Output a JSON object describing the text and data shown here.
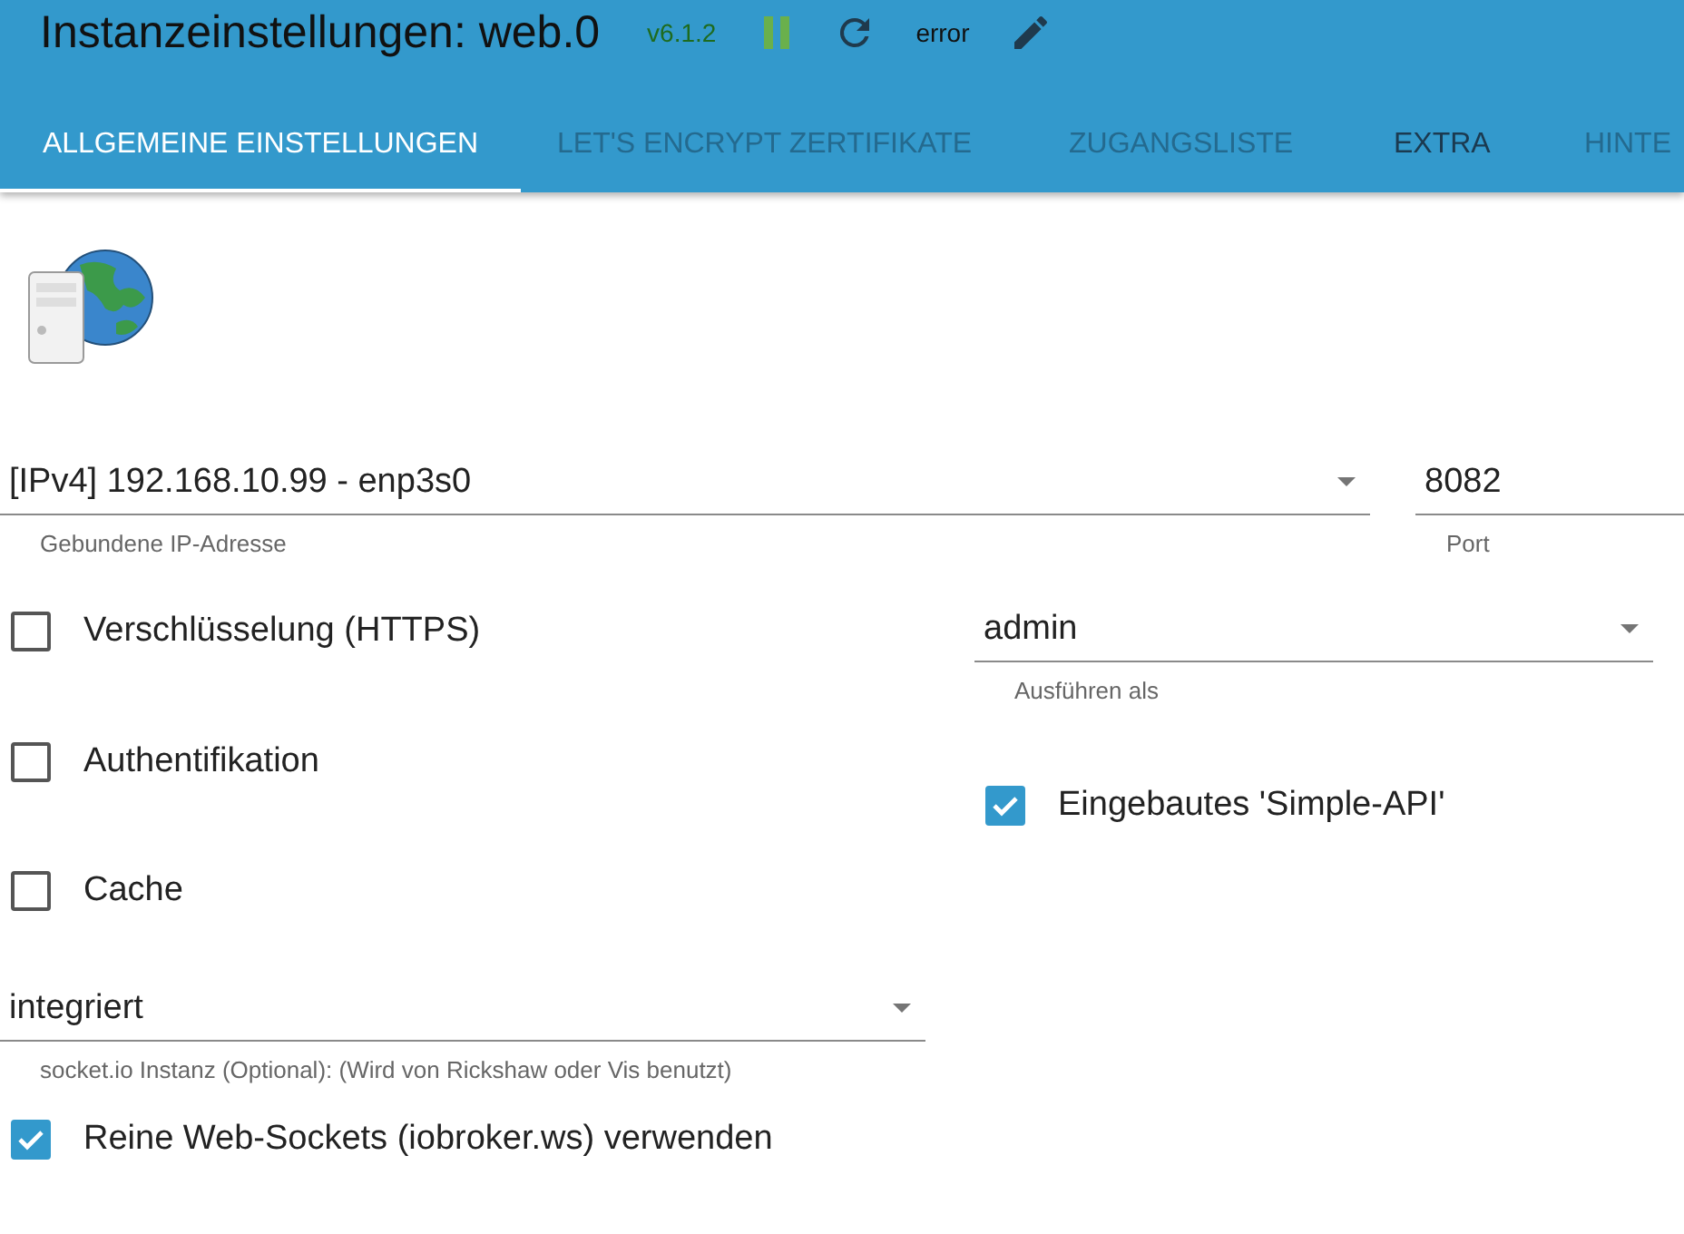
{
  "header": {
    "title": "Instanzeinstellungen: web.0",
    "version": "v6.1.2",
    "running": true,
    "status": "error"
  },
  "tabs": [
    {
      "label": "ALLGEMEINE EINSTELLUNGEN",
      "selected": true,
      "hover": false
    },
    {
      "label": "LET'S ENCRYPT ZERTIFIKATE",
      "selected": false,
      "hover": false
    },
    {
      "label": "ZUGANGSLISTE",
      "selected": false,
      "hover": false
    },
    {
      "label": "EXTRA",
      "selected": false,
      "hover": true
    },
    {
      "label": "HINTE",
      "selected": false,
      "hover": false
    }
  ],
  "bind": {
    "value": "[IPv4] 192.168.10.99 - enp3s0",
    "helper": "Gebundene IP-Adresse"
  },
  "port": {
    "value": "8082",
    "helper": "Port"
  },
  "left_options": [
    {
      "label": "Verschlüsselung (HTTPS)",
      "checked": false
    },
    {
      "label": "Authentifikation",
      "checked": false
    },
    {
      "label": "Cache",
      "checked": false
    }
  ],
  "run_as": {
    "value": "admin",
    "helper": "Ausführen als"
  },
  "simple_api": {
    "label": "Eingebautes 'Simple-API'",
    "checked": true
  },
  "socketio": {
    "value": "integriert",
    "helper": "socket.io Instanz (Optional): (Wird von Rickshaw oder Vis benutzt)"
  },
  "websockets": {
    "label": "Reine Web-Sockets (iobroker.ws) verwenden",
    "checked": true
  }
}
